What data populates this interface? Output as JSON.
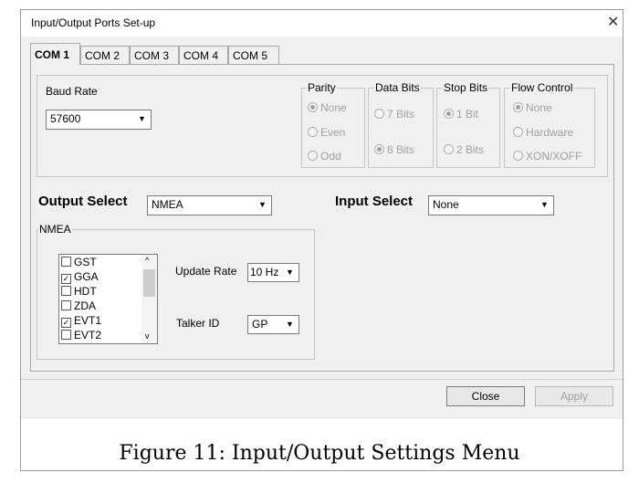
{
  "window": {
    "title": "Input/Output Ports Set-up",
    "close_glyph": "✕"
  },
  "tabs": [
    {
      "label": "COM 1",
      "active": true
    },
    {
      "label": "COM 2"
    },
    {
      "label": "COM 3"
    },
    {
      "label": "COM 4"
    },
    {
      "label": "COM 5"
    }
  ],
  "baud": {
    "label": "Baud Rate",
    "value": "57600"
  },
  "parity": {
    "label": "Parity",
    "options": [
      "None",
      "Even",
      "Odd"
    ],
    "selected": "None"
  },
  "data_bits": {
    "label": "Data Bits",
    "options": [
      "7 Bits",
      "8 Bits"
    ],
    "selected": "8 Bits"
  },
  "stop_bits": {
    "label": "Stop Bits",
    "options": [
      "1 Bit",
      "2 Bits"
    ],
    "selected": "1 Bit"
  },
  "flow_control": {
    "label": "Flow Control",
    "options": [
      "None",
      "Hardware",
      "XON/XOFF"
    ],
    "selected": "None"
  },
  "output_select": {
    "label": "Output Select",
    "value": "NMEA"
  },
  "input_select": {
    "label": "Input Select",
    "value": "None"
  },
  "nmea": {
    "group_label": "NMEA",
    "messages": [
      {
        "label": "GST",
        "checked": false
      },
      {
        "label": "GGA",
        "checked": true
      },
      {
        "label": "HDT",
        "checked": false
      },
      {
        "label": "ZDA",
        "checked": false
      },
      {
        "label": "EVT1",
        "checked": true
      },
      {
        "label": "EVT2",
        "checked": false
      }
    ],
    "update_rate": {
      "label": "Update Rate",
      "value": "10 Hz"
    },
    "talker_id": {
      "label": "Talker ID",
      "value": "GP"
    }
  },
  "buttons": {
    "close": "Close",
    "apply": "Apply"
  },
  "caption": "Figure 11: Input/Output Settings Menu"
}
